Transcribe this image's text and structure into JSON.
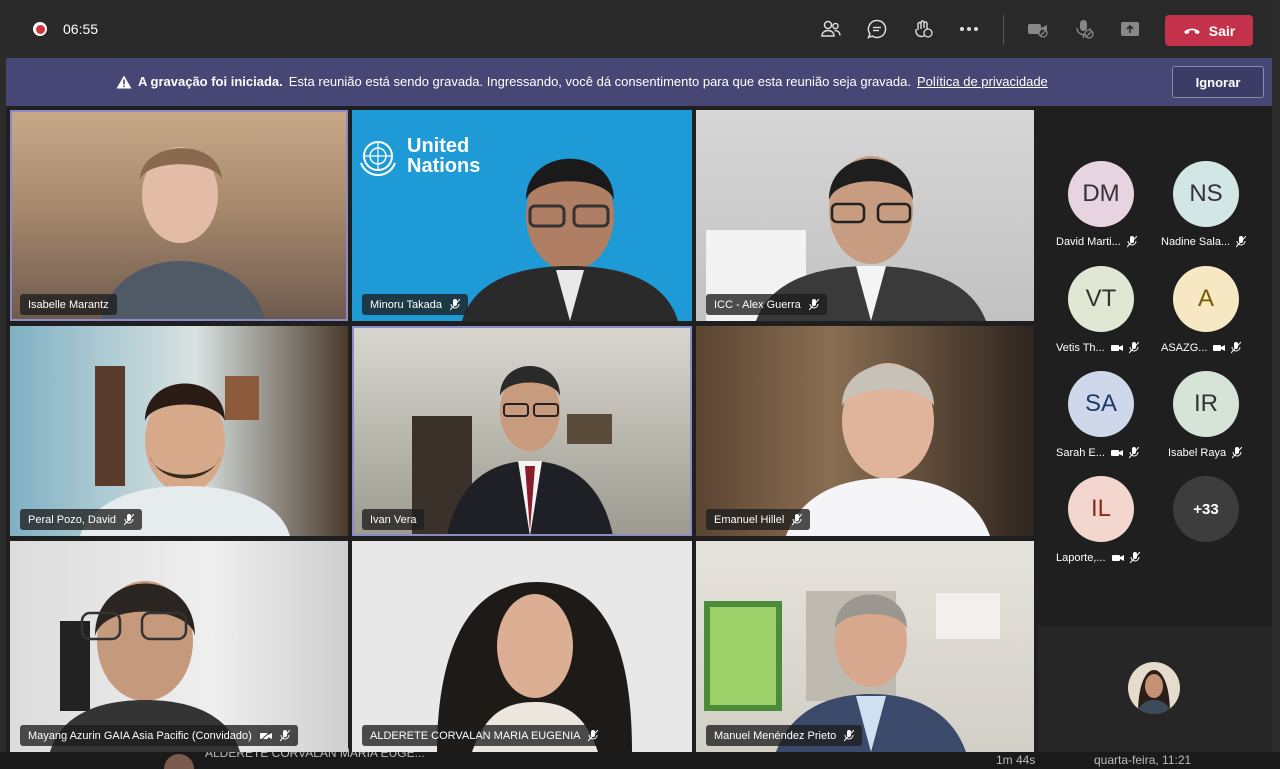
{
  "topbar": {
    "timer": "06:55",
    "leave_label": "Sair",
    "icons": [
      "participants-icon",
      "chat-icon",
      "reactions-icon",
      "more-icon",
      "camera-off-icon",
      "mic-off-icon",
      "share-icon"
    ]
  },
  "banner": {
    "bold": "A gravação foi iniciada.",
    "text": "Esta reunião está sendo gravada. Ingressando, você dá consentimento para que esta reunião seja gravada.",
    "link": "Política de privacidade",
    "ignore_label": "Ignorar"
  },
  "un_logo": {
    "line1": "United",
    "line2": "Nations"
  },
  "tiles": [
    {
      "name": "Isabelle Marantz",
      "mic_off": false,
      "cam_off": false
    },
    {
      "name": "Minoru Takada",
      "mic_off": true,
      "cam_off": false
    },
    {
      "name": "ICC - Alex Guerra",
      "mic_off": true,
      "cam_off": false
    },
    {
      "name": "Peral Pozo, David",
      "mic_off": true,
      "cam_off": false
    },
    {
      "name": "Ivan Vera",
      "mic_off": false,
      "cam_off": false
    },
    {
      "name": "Emanuel Hillel",
      "mic_off": true,
      "cam_off": false
    },
    {
      "name": "Mayang Azurin GAIA Asia Pacific (Convidado)",
      "mic_off": true,
      "cam_off": true
    },
    {
      "name": "ALDERETE CORVALAN MARIA EUGENIA",
      "mic_off": true,
      "cam_off": false
    },
    {
      "name": "Manuel Menéndez Prieto",
      "mic_off": true,
      "cam_off": false
    }
  ],
  "roster": [
    {
      "initials": "DM",
      "label": "David Marti...",
      "color": "#e8d3e0",
      "cam_off": false
    },
    {
      "initials": "NS",
      "label": "Nadine Sala...",
      "color": "#d3e6e6",
      "cam_off": false
    },
    {
      "initials": "VT",
      "label": "Vetis Th...",
      "color": "#e2e7d4",
      "cam_off": true
    },
    {
      "initials": "A",
      "label": "ASAZG...",
      "color": "#f6e8c2",
      "cam_off": true
    },
    {
      "initials": "SA",
      "label": "Sarah E...",
      "color": "#cfd8ea",
      "cam_off": true
    },
    {
      "initials": "IR",
      "label": "Isabel Raya",
      "color": "#d5e4d6",
      "cam_off": false
    },
    {
      "initials": "IL",
      "label": "Laporte,...",
      "color": "#f3d6ce",
      "cam_off": true
    }
  ],
  "roster_more": "+33",
  "behind": {
    "name": "ALDERETE CORVALAN MARIA EUGE...",
    "duration": "1m 44s",
    "date": "quarta-feira, 11:21"
  },
  "colors": {
    "banner": "#464775",
    "leave": "#c4314b",
    "active_outline": "#8b8cc7"
  }
}
